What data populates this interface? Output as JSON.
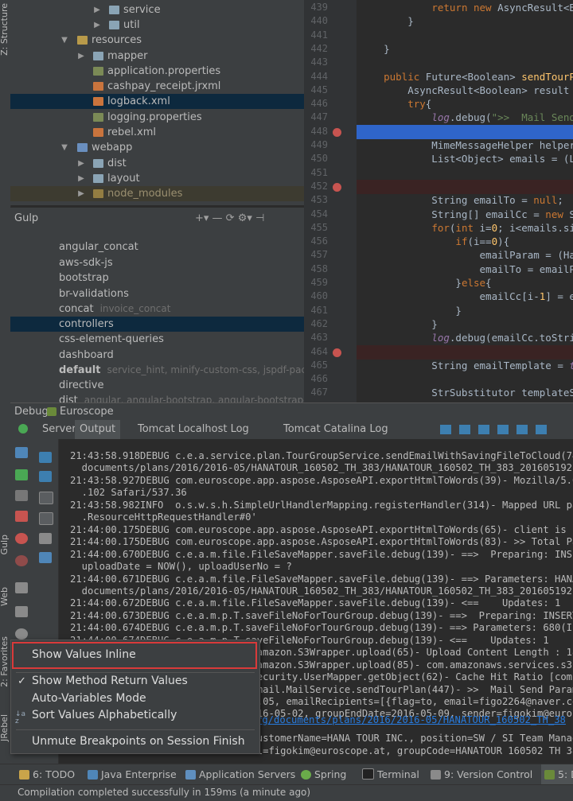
{
  "left_strip": {
    "tabs": [
      "Z: Structure",
      "Gulp",
      "Web",
      "2: Favorites",
      "JRebel"
    ]
  },
  "project_tree": {
    "rows": [
      {
        "label": "service",
        "arrow": "▶",
        "kind": "folder"
      },
      {
        "label": "util",
        "arrow": "▶",
        "kind": "folder"
      },
      {
        "label": "resources",
        "arrow": "▼",
        "kind": "folder-res"
      },
      {
        "label": "mapper",
        "arrow": "▶",
        "kind": "folder"
      },
      {
        "label": "application.properties",
        "arrow": "",
        "kind": "file-prop"
      },
      {
        "label": "cashpay_receipt.jrxml",
        "arrow": "",
        "kind": "file-xml"
      },
      {
        "label": "logback.xml",
        "arrow": "",
        "kind": "file-xml"
      },
      {
        "label": "logging.properties",
        "arrow": "",
        "kind": "file-prop"
      },
      {
        "label": "rebel.xml",
        "arrow": "",
        "kind": "file-xml"
      },
      {
        "label": "webapp",
        "arrow": "▼",
        "kind": "folder-web"
      },
      {
        "label": "dist",
        "arrow": "▶",
        "kind": "folder"
      },
      {
        "label": "layout",
        "arrow": "▶",
        "kind": "folder"
      },
      {
        "label": "node_modules",
        "arrow": "▶",
        "kind": "folder"
      }
    ]
  },
  "gulp": {
    "title": "Gulp",
    "toolbar": "+▾  —  ⟳  ⚙▾  ⊣",
    "tasks": [
      {
        "name": "angular_concat",
        "deps": ""
      },
      {
        "name": "aws-sdk-js",
        "deps": ""
      },
      {
        "name": "bootstrap",
        "deps": ""
      },
      {
        "name": "br-validations",
        "deps": ""
      },
      {
        "name": "concat",
        "deps": "invoice_concat"
      },
      {
        "name": "controllers",
        "deps": ""
      },
      {
        "name": "css-element-queries",
        "deps": ""
      },
      {
        "name": "dashboard",
        "deps": ""
      },
      {
        "name": "default",
        "deps": "service_hint, minify-custom-css, jspdf-packag"
      },
      {
        "name": "directive",
        "deps": ""
      },
      {
        "name": "dist",
        "deps": "angular, angular-bootstrap, angular-bootstrap-co"
      }
    ]
  },
  "editor": {
    "lines": [
      {
        "n": "439",
        "bp": false,
        "html": "            <span class='kw'>return new</span> AsyncResult&lt;Bo"
      },
      {
        "n": "440",
        "bp": false,
        "html": "        }"
      },
      {
        "n": "441",
        "bp": false,
        "html": ""
      },
      {
        "n": "442",
        "bp": false,
        "html": "    }"
      },
      {
        "n": "443",
        "bp": false,
        "html": ""
      },
      {
        "n": "444",
        "bp": false,
        "html": "    <span class='kw'>public</span> Future&lt;Boolean&gt; <span class='fn'>sendTourPla</span>"
      },
      {
        "n": "445",
        "bp": false,
        "html": "        AsyncResult&lt;Boolean&gt; result ="
      },
      {
        "n": "446",
        "bp": false,
        "html": "        <span class='kw'>try</span>{"
      },
      {
        "n": "447",
        "bp": false,
        "html": "            <span class='it'>log</span>.debug(<span class='str'>\"&gt;&gt;  Mail Send F</span>"
      },
      {
        "n": "448",
        "bp": true,
        "html": "            MimeMessage message = <span class='it'>eurc</span>"
      },
      {
        "n": "449",
        "bp": false,
        "html": "            MimeMessageHelper helper ="
      },
      {
        "n": "450",
        "bp": false,
        "html": "            List&lt;Object&gt; emails = (Lis"
      },
      {
        "n": "451",
        "bp": false,
        "html": ""
      },
      {
        "n": "452",
        "bp": true,
        "html": "            HashMap&lt;String, Object&gt; em"
      },
      {
        "n": "453",
        "bp": false,
        "html": "            String emailTo = <span class='kw'>null</span>;"
      },
      {
        "n": "454",
        "bp": false,
        "html": "            String[] emailCc = <span class='kw'>new</span> Str"
      },
      {
        "n": "455",
        "bp": false,
        "html": "            <span class='kw'>for</span>(<span class='kw'>int</span> i=<span class='fn'>0</span>; i&lt;emails.size"
      },
      {
        "n": "456",
        "bp": false,
        "html": "                <span class='kw'>if</span>(i==<span class='fn'>0</span>){"
      },
      {
        "n": "457",
        "bp": false,
        "html": "                    emailParam = (Hash"
      },
      {
        "n": "458",
        "bp": false,
        "html": "                    emailTo = emailPar"
      },
      {
        "n": "459",
        "bp": false,
        "html": "                }<span class='kw'>else</span>{"
      },
      {
        "n": "460",
        "bp": false,
        "html": "                    emailCc[i-<span class='fn'>1</span>] = ema"
      },
      {
        "n": "461",
        "bp": false,
        "html": "                }"
      },
      {
        "n": "462",
        "bp": false,
        "html": "            }"
      },
      {
        "n": "463",
        "bp": false,
        "html": "            <span class='it'>log</span>.debug(emailCc.toString"
      },
      {
        "n": "464",
        "bp": true,
        "html": "            String body = <span class='kw'>null</span>;"
      },
      {
        "n": "465",
        "bp": false,
        "html": "            String emailTemplate = <span class='it'>tem</span>"
      },
      {
        "n": "466",
        "bp": false,
        "html": ""
      },
      {
        "n": "467",
        "bp": false,
        "html": "            StrSubstitutor templateSub"
      }
    ]
  },
  "debug": {
    "title": "Debug",
    "config": "Euroscope",
    "tabs": [
      "Server",
      "Output",
      "Tomcat Localhost Log",
      "Tomcat Catalina Log"
    ],
    "console": [
      "21:43:58.918DEBUG c.e.a.service.plan.TourGroupService.sendEmailWithSavingFileToCloud(743)",
      "  documents/plans/2016/2016-05/HANATOUR_160502_TH_383/HANATOUR_160502_TH_383_20160519214358",
      "21:43:58.927DEBUG com.euroscope.app.aspose.AsposeAPI.exportHtmlToWords(39)- Mozilla/5.0 (M",
      "  .102 Safari/537.36",
      "21:43:58.982INFO  o.s.w.s.h.SimpleUrlHandlerMapping.registerHandler(314)- Mapped URL path",
      "  .ResourceHttpRequestHandler#0'",
      "21:44:00.175DEBUG com.euroscope.app.aspose.AsposeAPI.exportHtmlToWords(65)- client is not",
      "21:44:00.175DEBUG com.euroscope.app.aspose.AsposeAPI.exportHtmlToWords(83)- >> Total Page",
      "21:44:00.670DEBUG c.e.a.m.file.FileSaveMapper.saveFile.debug(139)- ==>  Preparing: INSERT",
      "  uploadDate = NOW(), uploadUserNo = ?",
      "21:44:00.671DEBUG c.e.a.m.file.FileSaveMapper.saveFile.debug(139)- ==> Parameters: HANATO",
      "  documents/plans/2016/2016-05/HANATOUR_160502_TH_383/HANATOUR_160502_TH_383_20160519214358",
      "21:44:00.672DEBUG c.e.a.m.file.FileSaveMapper.saveFile.debug(139)- <==    Updates: 1",
      "21:44:00.673DEBUG c.e.a.m.p.T.saveFileNoForTourGroup.debug(139)- ==>  Preparing: INSERT I",
      "21:44:00.674DEBUG c.e.a.m.p.T.saveFileNoForTourGroup.debug(139)- ==> Parameters: 680(Inte",
      "21:44:00.674DEBUG c.e.a.m.p.T.saveFileNoForTourGroup.debug(139)- <==    Updates: 1",
      "                                amazon.S3Wrapper.upload(65)- Upload Content Length : 18",
      "                                amazon.S3Wrapper.upload(85)- com.amazonaws.services.s3.",
      "                                ecurity.UserMapper.getObject(62)- Cache Hit Ratio [com.",
      "                                mail.MailService.sendTourPlan(447)- >>  Mail Send Param",
      "                                .05, emailRecipients=[{flag=to, email=figo2264@naver.com}",
      "                                16-05-02, groupEndDate=2016-05-09, sender=figokim@euroscope",
      "                                ",
      "                                ustomerName=HANA TOUR INC., position=SW / SI Team Manager",
      "                                l=figokim@euroscope.at, groupCode=HANATOUR 160502 TH 383"
    ],
    "console_link": "e.org/documents/plans/2016/2016-05/HANATOUR_160502_TH_38"
  },
  "context_menu": {
    "items": [
      {
        "label": "Show Values Inline",
        "check": "",
        "highlighted": true
      },
      {
        "label": "Show Method Return Values",
        "check": "✓",
        "highlighted": false
      },
      {
        "label": "Auto-Variables Mode",
        "check": "",
        "highlighted": false
      },
      {
        "label": "Sort Values Alphabetically",
        "check": "↓a z",
        "highlighted": false
      },
      {
        "label": "Unmute Breakpoints on Session Finish",
        "check": "",
        "highlighted": false
      }
    ]
  },
  "bottom_bar": {
    "items": [
      "6: TODO",
      "Java Enterprise",
      "Application Servers",
      "Spring",
      "Terminal",
      "9: Version Control",
      "5: D"
    ]
  },
  "status": {
    "text": "Compilation completed successfully in 159ms (a minute ago)"
  }
}
